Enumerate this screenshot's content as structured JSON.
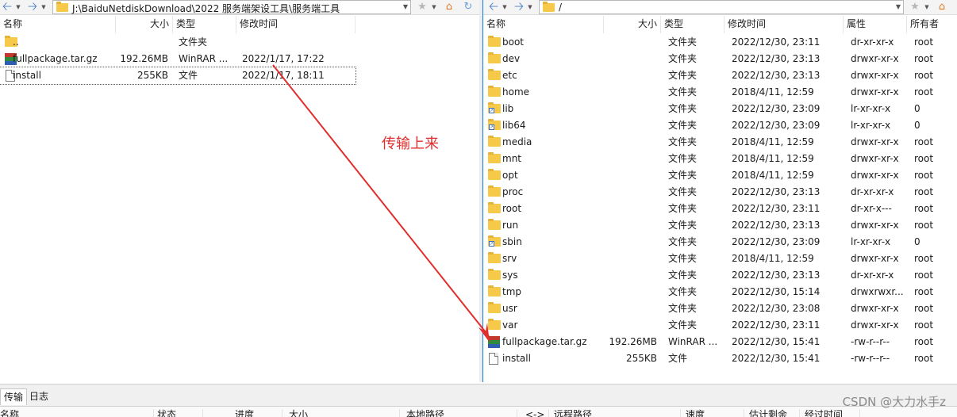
{
  "left": {
    "path": "J:\\BaiduNetdiskDownload\\2022 服务端架设工具\\服务端工具",
    "columns": [
      "名称",
      "大小",
      "类型",
      "修改时间"
    ],
    "rows": [
      {
        "icon": "folder",
        "name": "..",
        "size": "",
        "type": "文件夹",
        "mtime": ""
      },
      {
        "icon": "rar",
        "name": "fullpackage.tar.gz",
        "size": "192.26MB",
        "type": "WinRAR ...",
        "mtime": "2022/1/17, 17:22"
      },
      {
        "icon": "file",
        "name": "install",
        "size": "255KB",
        "type": "文件",
        "mtime": "2022/1/17, 18:11",
        "focused": true
      }
    ]
  },
  "right": {
    "path": "/",
    "columns": [
      "名称",
      "大小",
      "类型",
      "修改时间",
      "属性",
      "所有者"
    ],
    "rows": [
      {
        "icon": "folder",
        "name": "boot",
        "size": "",
        "type": "文件夹",
        "mtime": "2022/12/30, 23:11",
        "attr": "dr-xr-xr-x",
        "owner": "root"
      },
      {
        "icon": "folder",
        "name": "dev",
        "size": "",
        "type": "文件夹",
        "mtime": "2022/12/30, 23:13",
        "attr": "drwxr-xr-x",
        "owner": "root"
      },
      {
        "icon": "folder",
        "name": "etc",
        "size": "",
        "type": "文件夹",
        "mtime": "2022/12/30, 23:13",
        "attr": "drwxr-xr-x",
        "owner": "root"
      },
      {
        "icon": "folder",
        "name": "home",
        "size": "",
        "type": "文件夹",
        "mtime": "2018/4/11, 12:59",
        "attr": "drwxr-xr-x",
        "owner": "root"
      },
      {
        "icon": "folder-link",
        "name": "lib",
        "size": "",
        "type": "文件夹",
        "mtime": "2022/12/30, 23:09",
        "attr": "lr-xr-xr-x",
        "owner": "0"
      },
      {
        "icon": "folder-link",
        "name": "lib64",
        "size": "",
        "type": "文件夹",
        "mtime": "2022/12/30, 23:09",
        "attr": "lr-xr-xr-x",
        "owner": "0"
      },
      {
        "icon": "folder",
        "name": "media",
        "size": "",
        "type": "文件夹",
        "mtime": "2018/4/11, 12:59",
        "attr": "drwxr-xr-x",
        "owner": "root"
      },
      {
        "icon": "folder",
        "name": "mnt",
        "size": "",
        "type": "文件夹",
        "mtime": "2018/4/11, 12:59",
        "attr": "drwxr-xr-x",
        "owner": "root"
      },
      {
        "icon": "folder",
        "name": "opt",
        "size": "",
        "type": "文件夹",
        "mtime": "2018/4/11, 12:59",
        "attr": "drwxr-xr-x",
        "owner": "root"
      },
      {
        "icon": "folder",
        "name": "proc",
        "size": "",
        "type": "文件夹",
        "mtime": "2022/12/30, 23:13",
        "attr": "dr-xr-xr-x",
        "owner": "root"
      },
      {
        "icon": "folder",
        "name": "root",
        "size": "",
        "type": "文件夹",
        "mtime": "2022/12/30, 23:11",
        "attr": "dr-xr-x---",
        "owner": "root"
      },
      {
        "icon": "folder",
        "name": "run",
        "size": "",
        "type": "文件夹",
        "mtime": "2022/12/30, 23:13",
        "attr": "drwxr-xr-x",
        "owner": "root"
      },
      {
        "icon": "folder-link",
        "name": "sbin",
        "size": "",
        "type": "文件夹",
        "mtime": "2022/12/30, 23:09",
        "attr": "lr-xr-xr-x",
        "owner": "0"
      },
      {
        "icon": "folder",
        "name": "srv",
        "size": "",
        "type": "文件夹",
        "mtime": "2018/4/11, 12:59",
        "attr": "drwxr-xr-x",
        "owner": "root"
      },
      {
        "icon": "folder",
        "name": "sys",
        "size": "",
        "type": "文件夹",
        "mtime": "2022/12/30, 23:13",
        "attr": "dr-xr-xr-x",
        "owner": "root"
      },
      {
        "icon": "folder",
        "name": "tmp",
        "size": "",
        "type": "文件夹",
        "mtime": "2022/12/30, 15:14",
        "attr": "drwxrwxr...",
        "owner": "root"
      },
      {
        "icon": "folder",
        "name": "usr",
        "size": "",
        "type": "文件夹",
        "mtime": "2022/12/30, 23:08",
        "attr": "drwxr-xr-x",
        "owner": "root"
      },
      {
        "icon": "folder",
        "name": "var",
        "size": "",
        "type": "文件夹",
        "mtime": "2022/12/30, 23:11",
        "attr": "drwxr-xr-x",
        "owner": "root"
      },
      {
        "icon": "rar",
        "name": "fullpackage.tar.gz",
        "size": "192.26MB",
        "type": "WinRAR ...",
        "mtime": "2022/12/30, 15:41",
        "attr": "-rw-r--r--",
        "owner": "root"
      },
      {
        "icon": "file",
        "name": "install",
        "size": "255KB",
        "type": "文件",
        "mtime": "2022/12/30, 15:41",
        "attr": "-rw-r--r--",
        "owner": "root"
      }
    ]
  },
  "bottom": {
    "tabs": [
      "传输",
      "日志"
    ],
    "queue_columns": [
      "名称",
      "状态",
      "进度",
      "大小",
      "本地路径",
      "<->",
      "远程路径",
      "速度",
      "估计剩余",
      "经过时间"
    ]
  },
  "annotation": {
    "text": "传输上来",
    "color": "#e22d2d"
  },
  "watermark": "CSDN @大力水手z",
  "colors": {
    "accent_border": "#1e78d6",
    "folder": "#f7c948",
    "nav_arrow": "#4a7fc4"
  },
  "icons": {
    "back": "arrow-left-icon",
    "forward": "arrow-right-icon",
    "bookmark": "star-icon",
    "home": "home-icon",
    "refresh": "refresh-icon"
  }
}
